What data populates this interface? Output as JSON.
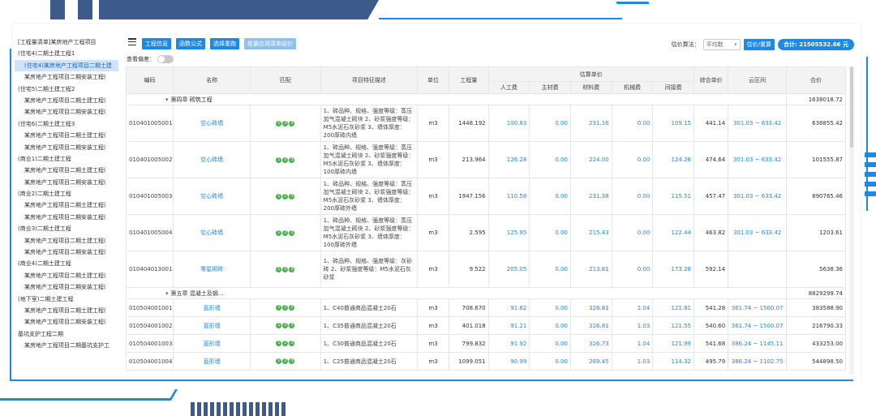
{
  "sidebar": {
    "items": [
      {
        "label": "[工程量清单]某房地产工程项目",
        "level": 1
      },
      {
        "label": "(住宅4)二期土建工程1",
        "level": 1
      },
      {
        "label": "(住宅4)某房地产工程项目二期土建",
        "level": 2
      },
      {
        "label": "某房地产工程项目二期安装工程(",
        "level": 2
      },
      {
        "label": "(住宅5)二期土建工程2",
        "level": 1
      },
      {
        "label": "某房地产工程项目二期土建工程(",
        "level": 2
      },
      {
        "label": "某房地产工程项目二期安装工程(",
        "level": 2
      },
      {
        "label": "(住宅6)二期土建工程3",
        "level": 1
      },
      {
        "label": "某房地产工程项目二期土建工程(",
        "level": 2
      },
      {
        "label": "某房地产工程项目二期安装工程(",
        "level": 2
      },
      {
        "label": "(商业1)二期土建工程",
        "level": 1
      },
      {
        "label": "某房地产工程项目二期土建工程(",
        "level": 2
      },
      {
        "label": "某房地产工程项目二期安装工程(",
        "level": 2
      },
      {
        "label": "(商业2)二期土建工程",
        "level": 1
      },
      {
        "label": "某房地产工程项目二期土建工程(",
        "level": 2
      },
      {
        "label": "某房地产工程项目二期安装工程(",
        "level": 2
      },
      {
        "label": "(商业3)二期土建工程",
        "level": 1
      },
      {
        "label": "某房地产工程项目二期土建工程(",
        "level": 2
      },
      {
        "label": "某房地产工程项目二期安装工程(",
        "level": 2
      },
      {
        "label": "(商业4)二期土建工程",
        "level": 1
      },
      {
        "label": "某房地产工程项目二期土建工程(",
        "level": 2
      },
      {
        "label": "某房地产工程项目二期安装工程(",
        "level": 2
      },
      {
        "label": "(地下室)二期土建工程",
        "level": 1
      },
      {
        "label": "某房地产工程项目二期土建工程(",
        "level": 2
      },
      {
        "label": "某房地产工程项目二期安装工程(",
        "level": 2
      },
      {
        "label": "基坑支护工程二期",
        "level": 1
      },
      {
        "label": "某房地产工程项目二期基坑支护工",
        "level": 2
      }
    ],
    "selected_index": 2
  },
  "toolbar": {
    "buttons": [
      "工程信息",
      "函数公式",
      "选择重跑",
      "批量应用清单组价"
    ],
    "price_label": "估价算法：",
    "price_select_value": "平均数",
    "estimate_button": "估价/重算",
    "total": "合计: 21505532.66 元",
    "view_label": "查看偏差："
  },
  "table": {
    "headers": {
      "code": "编码",
      "name": "名称",
      "match": "匹配",
      "desc": "项目特征描述",
      "unit": "单位",
      "qty": "工程量",
      "est_group": "估算单价",
      "labor": "人工费",
      "main_mat": "主材费",
      "mat": "材料费",
      "mach": "机械费",
      "mgmt": "间接费",
      "unit_price": "综合单价",
      "cloud": "云区间",
      "total": "合价"
    },
    "rows": [
      {
        "type": "group",
        "title": "第四章 砌筑工程",
        "total": "1638018.72"
      },
      {
        "type": "item",
        "code": "010401005001",
        "name": "空心砖墙",
        "desc": "1、砖品种、规格、强度等级：蒸压加气混凝土砌块 2、砂浆强度等级：M5水泥石灰砂浆 3、墙体厚度：200厚砖内墙",
        "unit": "m3",
        "qty": "1448.192",
        "labor": "100.83",
        "main_mat": "0.00",
        "mat": "231.16",
        "mach": "0.00",
        "mgmt": "109.15",
        "unit_price": "441.14",
        "cloud": "301.03 ~ 633.42",
        "total": "638855.42"
      },
      {
        "type": "item",
        "code": "010401005002",
        "name": "空心砖墙",
        "desc": "1、砖品种、规格、强度等级：蒸压加气混凝土砌块 2、砂浆强度等级：M5水泥石灰砂浆 3、墙体厚度：100厚砖内墙",
        "unit": "m3",
        "qty": "213.964",
        "labor": "126.28",
        "main_mat": "0.00",
        "mat": "224.00",
        "mach": "0.00",
        "mgmt": "124.26",
        "unit_price": "474.64",
        "cloud": "301.03 ~ 633.42",
        "total": "101555.87"
      },
      {
        "type": "item",
        "code": "010401005003",
        "name": "空心砖墙",
        "desc": "1、砖品种、规格、强度等级：蒸压加气混凝土砌块 2、砂浆强度等级：M5水泥石灰砂浆 3、墙体厚度：200厚砖外墙",
        "unit": "m3",
        "qty": "1947.156",
        "labor": "110.58",
        "main_mat": "0.00",
        "mat": "231.38",
        "mach": "0.00",
        "mgmt": "115.51",
        "unit_price": "457.47",
        "cloud": "301.03 ~ 633.42",
        "total": "890765.46"
      },
      {
        "type": "item",
        "code": "010401005004",
        "name": "空心砖墙",
        "desc": "1、砖品种、规格、强度等级：蒸压加气混凝土砌块 2、砂浆强度等级：M5水泥石灰砂浆 3、墙体厚度：100厚砖外墙",
        "unit": "m3",
        "qty": "2.595",
        "labor": "125.95",
        "main_mat": "0.00",
        "mat": "215.43",
        "mach": "0.00",
        "mgmt": "122.44",
        "unit_price": "463.82",
        "cloud": "301.03 ~ 633.42",
        "total": "1203.61"
      },
      {
        "type": "item",
        "code": "010404013001",
        "name": "零星砌砖",
        "desc": "1、砖品种、规格、强度等级：灰砂砖 2、砂浆强度等级：M5水泥石灰砂浆",
        "unit": "m3",
        "qty": "9.522",
        "labor": "205.05",
        "main_mat": "0.00",
        "mat": "213.81",
        "mach": "0.00",
        "mgmt": "173.28",
        "unit_price": "592.14",
        "cloud": "",
        "total": "5638.36"
      },
      {
        "type": "group",
        "title": "第五章 混凝土及钢...",
        "total": "8829299.74"
      },
      {
        "type": "item",
        "code": "010504001001",
        "name": "直形墙",
        "desc": "1、C40普通商品混凝土20石",
        "unit": "m3",
        "qty": "708.670",
        "labor": "91.62",
        "main_mat": "0.00",
        "mat": "326.81",
        "mach": "1.04",
        "mgmt": "121.81",
        "unit_price": "541.28",
        "cloud": "361.74 ~ 1500.07",
        "total": "383588.90"
      },
      {
        "type": "item",
        "code": "010504001002",
        "name": "直形墙",
        "desc": "1、C35普通商品混凝土20石",
        "unit": "m3",
        "qty": "401.018",
        "labor": "91.21",
        "main_mat": "0.00",
        "mat": "326.81",
        "mach": "1.03",
        "mgmt": "121.55",
        "unit_price": "540.60",
        "cloud": "361.74 ~ 1500.07",
        "total": "216790.33"
      },
      {
        "type": "item",
        "code": "010504001003",
        "name": "直形墙",
        "desc": "1、C30普通商品混凝土20石",
        "unit": "m3",
        "qty": "799.832",
        "labor": "91.92",
        "main_mat": "0.00",
        "mat": "326.73",
        "mach": "1.04",
        "mgmt": "121.99",
        "unit_price": "541.68",
        "cloud": "386.24 ~ 1145.11",
        "total": "433253.00"
      },
      {
        "type": "item",
        "code": "010504001004",
        "name": "直形墙",
        "desc": "1、C25普通商品混凝土20石",
        "unit": "m3",
        "qty": "1099.051",
        "labor": "90.99",
        "main_mat": "0.00",
        "mat": "289.45",
        "mach": "1.03",
        "mgmt": "114.32",
        "unit_price": "495.79",
        "cloud": "386.24 ~ 1102.75",
        "total": "544898.50"
      }
    ]
  },
  "colors": {
    "accent": "#1e88e5",
    "frame": "#3a5b8c",
    "match_chip": "#4caf50",
    "selected_bg": "#cfe4fb"
  }
}
